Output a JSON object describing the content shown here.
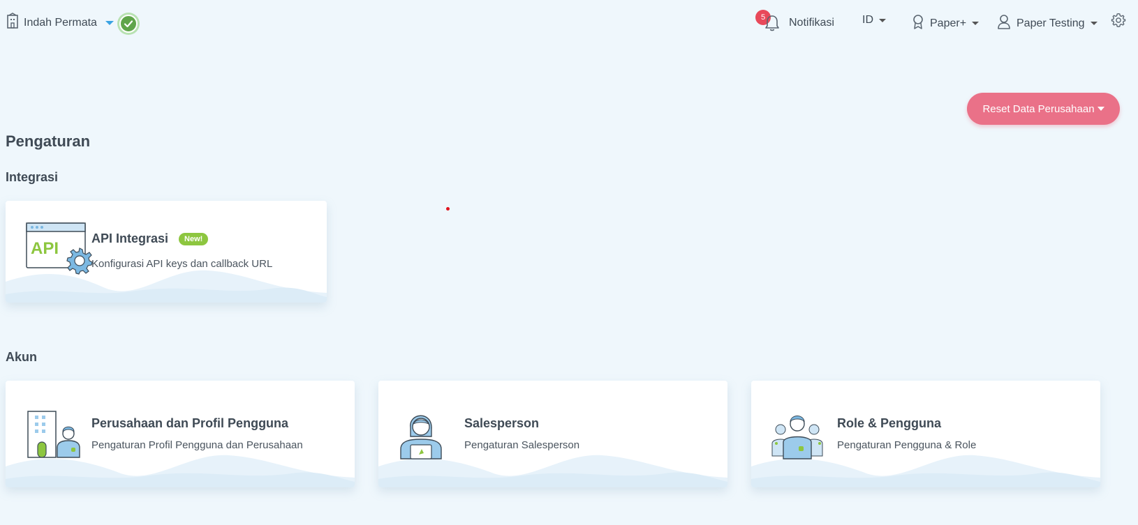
{
  "topbar": {
    "company_name": "Indah Permata",
    "notifications": {
      "count": "5",
      "label": "Notifikasi"
    },
    "language": "ID",
    "plan": "Paper+",
    "user": "Paper Testing"
  },
  "actions": {
    "reset_label": "Reset Data Perusahaan"
  },
  "page": {
    "title": "Pengaturan"
  },
  "sections": {
    "integrasi": {
      "title": "Integrasi",
      "cards": [
        {
          "title": "API Integrasi",
          "badge": "New!",
          "desc": "Konfigurasi API keys dan callback URL",
          "icon": "api-gear-icon",
          "icon_text": "API"
        }
      ]
    },
    "akun": {
      "title": "Akun",
      "cards": [
        {
          "title": "Perusahaan dan Profil Pengguna",
          "desc": "Pengaturan Profil Pengguna dan Perusahaan",
          "icon": "company-profile-icon"
        },
        {
          "title": "Salesperson",
          "desc": "Pengaturan Salesperson",
          "icon": "salesperson-icon"
        },
        {
          "title": "Role & Pengguna",
          "desc": "Pengaturan Pengguna & Role",
          "icon": "role-users-icon"
        }
      ]
    }
  },
  "colors": {
    "accent": "#3aa3e3",
    "reset_button": "#ea7188",
    "new_badge": "#8dc63f",
    "background": "#eff7fc"
  }
}
